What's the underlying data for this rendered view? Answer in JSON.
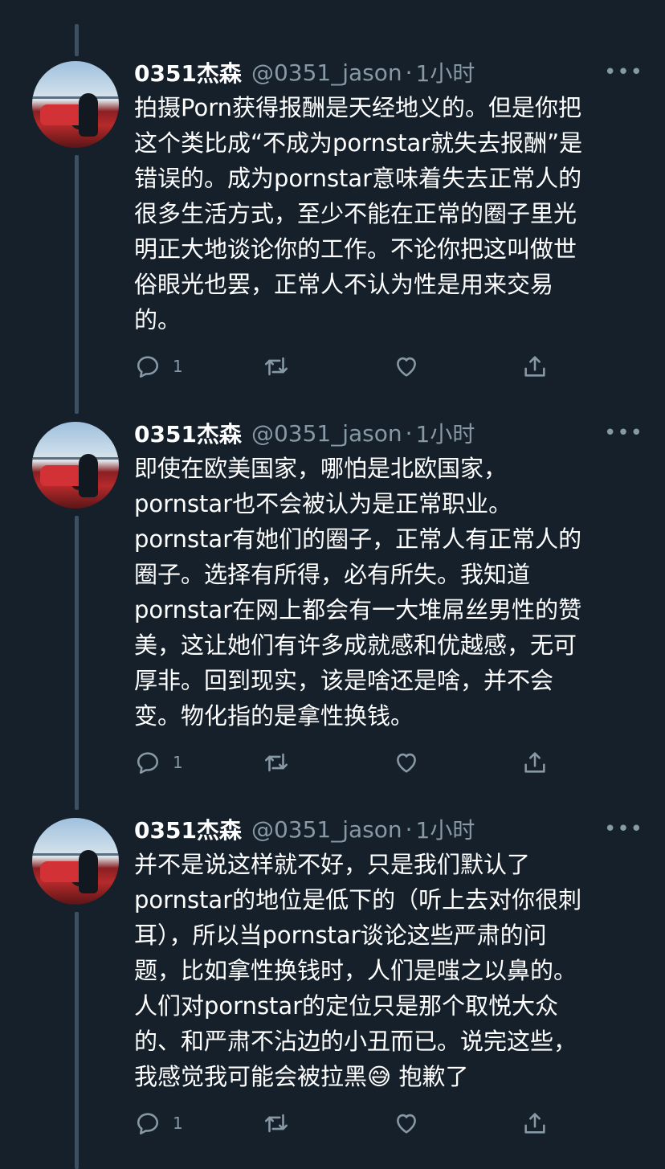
{
  "tweets": [
    {
      "name": "0351杰森",
      "handle": "@0351_jason",
      "separator": "·",
      "time": "1小时",
      "more": "•••",
      "text": "拍摄Porn获得报酬是天经地义的。但是你把\n这个类比成“不成为pornstar就失去报酬”是\n错误的。成为pornstar意味着失去正常人的\n很多生活方式，至少不能在正常的圈子里光\n明正大地谈论你的工作。不论你把这叫做世\n俗眼光也罢，正常人不认为性是用来交易\n的。",
      "reply_count": "1"
    },
    {
      "name": "0351杰森",
      "handle": "@0351_jason",
      "separator": "·",
      "time": "1小时",
      "more": "•••",
      "text": "即使在欧美国家，哪怕是北欧国家，\npornstar也不会被认为是正常职业。\npornstar有她们的圈子，正常人有正常人的\n圈子。选择有所得，必有所失。我知道\npornstar在网上都会有一大堆屌丝男性的赞\n美，这让她们有许多成就感和优越感，无可\n厚非。回到现实，该是啥还是啥，并不会\n变。物化指的是拿性换钱。",
      "reply_count": "1"
    },
    {
      "name": "0351杰森",
      "handle": "@0351_jason",
      "separator": "·",
      "time": "1小时",
      "more": "•••",
      "text": "并不是说这样就不好，只是我们默认了\npornstar的地位是低下的（听上去对你很刺\n耳），所以当pornstar谈论这些严肃的问\n题，比如拿性换钱时，人们是嗤之以鼻的。\n人们对pornstar的定位只是那个取悦大众\n的、和严肃不沾边的小丑而已。说完这些，\n我感觉我可能会被拉黑😅 抱歉了",
      "reply_count": "1"
    }
  ],
  "icons": {
    "reply": "reply-icon",
    "retweet": "retweet-icon",
    "like": "like-icon",
    "share": "share-icon",
    "more": "more-icon",
    "avatar": "avatar"
  },
  "colors": {
    "background": "#15202b",
    "text": "#ffffff",
    "secondary_text": "#8899a6",
    "thread_line": "#3d5166"
  }
}
